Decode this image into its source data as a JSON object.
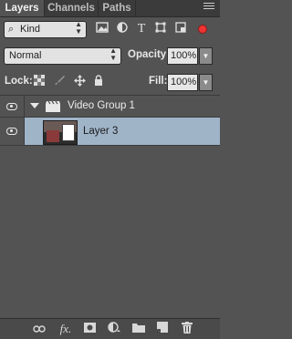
{
  "tabs": [
    {
      "label": "Layers",
      "active": true
    },
    {
      "label": "Channels",
      "active": false
    },
    {
      "label": "Paths",
      "active": false
    }
  ],
  "filter": {
    "kind_label": "Kind",
    "icons": [
      "pixel-filter-icon",
      "adjustment-filter-icon",
      "type-filter-icon",
      "shape-filter-icon",
      "smart-object-filter-icon"
    ],
    "toggle_color": "#e33333"
  },
  "blend": {
    "mode": "Normal",
    "opacity_label": "Opacity:",
    "opacity_value": "100%"
  },
  "lock": {
    "label": "Lock:",
    "icons": [
      "lock-transparent-icon",
      "lock-image-icon",
      "lock-position-icon",
      "lock-all-icon"
    ],
    "fill_label": "Fill:",
    "fill_value": "100%"
  },
  "layers": [
    {
      "type": "group",
      "name": "Video Group 1",
      "visible": true,
      "expanded": true
    },
    {
      "type": "layer",
      "name": "Layer 3",
      "visible": true,
      "selected": true
    }
  ],
  "bottom_icons": [
    "link-icon",
    "fx-icon",
    "mask-icon",
    "adjustment-icon",
    "new-group-icon",
    "new-layer-icon",
    "delete-icon"
  ],
  "colors": {
    "panel_bg": "#535353",
    "selected_row": "#a0b4c8",
    "tabbar_bg": "#3b3b3b"
  }
}
